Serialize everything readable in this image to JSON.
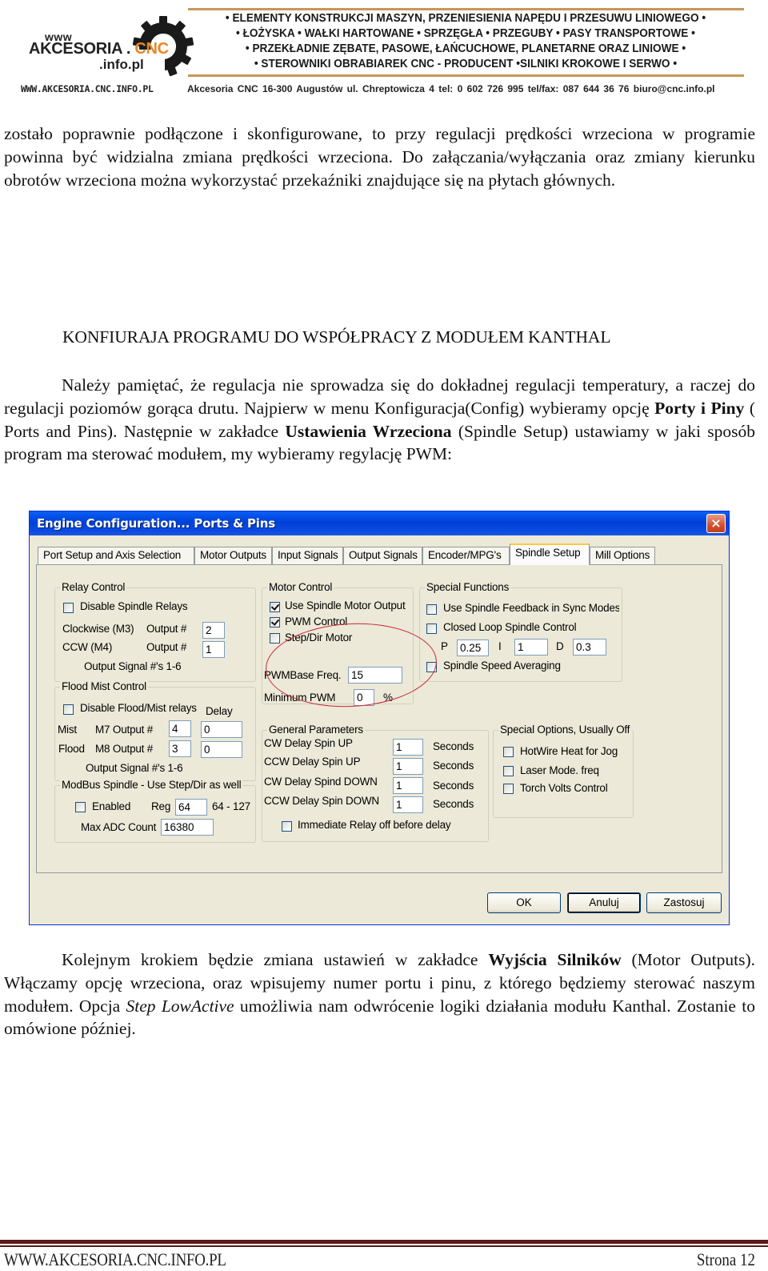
{
  "header": {
    "logo": {
      "www": "www",
      "name": "AKCESORIA . ",
      "cnc": "CNC",
      "domain": ".info.pl",
      "accent_color": "#e8872a"
    },
    "taglines": [
      "• ELEMENTY KONSTRUKCJI MASZYN, PRZENIESIENIA NAPĘDU I PRZESUWU LINIOWEGO •",
      "• ŁOŻYSKA • WAŁKI HARTOWANE • SPRZĘGŁA • PRZEGUBY •  PASY TRANSPORTOWE •",
      "• PRZEKŁADNIE ZĘBATE, PASOWE, ŁAŃCUCHOWE, PLANETARNE ORAZ LINIOWE •",
      "• STEROWNIKI OBRABIAREK CNC - PRODUCENT •SILNIKI KROKOWE I SERWO •"
    ],
    "website": "WWW.AKCESORIA.CNC.INFO.PL",
    "contact": "Akcesoria CNC   16-300 Augustów   ul. Chreptowicza 4    tel: 0 602 726 995 tel/fax: 087 644 36 76  biuro@cnc.info.pl"
  },
  "body": {
    "paragraph1": "zostało poprawnie podłączone i skonfigurowane, to przy regulacji prędkości wrzeciona w programie powinna być widzialna zmiana prędkości wrzeciona. Do załączania/wyłączania oraz zmiany kierunku obrotów wrzeciona można wykorzystać przekaźniki znajdujące się na płytach głównych.",
    "heading": "KONFIURAJA PROGRAMU DO WSPÓŁPRACY Z MODUŁEM KANTHAL",
    "paragraph2": {
      "part1": "Należy pamiętać, że regulacja nie sprowadza się do dokładnej regulacji temperatury, a raczej do regulacji poziomów gorąca drutu. Najpierw w menu Konfiguracja(Config) wybieramy opcję ",
      "bold1": "Porty i Piny",
      "part2": " ( Ports and Pins). Następnie w zakładce ",
      "bold2": "Ustawienia Wrzeciona",
      "part3": " (Spindle Setup) ustawiamy w jaki sposób program ma sterować modułem, my wybieramy regylację PWM:"
    },
    "paragraph3": {
      "part1": "Kolejnym krokiem będzie zmiana ustawień w zakładce ",
      "bold1": "Wyjścia Silników",
      "part2": " (Motor Outputs). Włączamy opcję wrzeciona, oraz wpisujemy numer portu i pinu, z którego będziemy sterować naszym modułem. Opcja ",
      "italic1": "Step LowActive",
      "part3": " umożliwia nam odwrócenie logiki działania modułu Kanthal. Zostanie to omówione później."
    }
  },
  "dialog": {
    "title": "Engine Configuration... Ports & Pins",
    "close_icon": "×",
    "tabs": [
      {
        "label": "Port Setup and Axis Selection",
        "active": false
      },
      {
        "label": "Motor Outputs",
        "active": false
      },
      {
        "label": "Input Signals",
        "active": false
      },
      {
        "label": "Output Signals",
        "active": false
      },
      {
        "label": "Encoder/MPG's",
        "active": false
      },
      {
        "label": "Spindle Setup",
        "active": true
      },
      {
        "label": "Mill Options",
        "active": false
      }
    ],
    "relay_control": {
      "legend": "Relay Control",
      "disable_label": "Disable Spindle Relays",
      "disable_checked": false,
      "cw_label": "Clockwise (M3)",
      "cw_output_label": "Output #",
      "cw_value": "2",
      "ccw_label": "CCW (M4)",
      "ccw_output_label": "Output #",
      "ccw_value": "1",
      "note": "Output Signal #'s 1-6"
    },
    "flood_mist": {
      "legend": "Flood Mist Control",
      "disable_label": "Disable Flood/Mist relays",
      "disable_checked": false,
      "delay_label": "Delay",
      "mist_label": "Mist",
      "mist_output_label": "M7 Output #",
      "mist_value": "4",
      "mist_delay": "0",
      "flood_label": "Flood",
      "flood_output_label": "M8 Output #",
      "flood_value": "3",
      "flood_delay": "0",
      "note": "Output Signal #'s 1-6"
    },
    "modbus": {
      "legend": "ModBus Spindle - Use Step/Dir as well",
      "enabled_label": "Enabled",
      "enabled_checked": false,
      "reg_label": "Reg",
      "reg_value": "64",
      "reg_range": "64 - 127",
      "max_adc_label": "Max ADC Count",
      "max_adc_value": "16380"
    },
    "motor_control": {
      "legend": "Motor Control",
      "use_spindle_label": "Use Spindle Motor Output",
      "use_spindle_checked": true,
      "pwm_label": "PWM Control",
      "pwm_checked": true,
      "stepdir_label": "Step/Dir Motor",
      "stepdir_checked": false,
      "pwm_base_label": "PWMBase Freq.",
      "pwm_base_value": "15",
      "min_pwm_label": "Minimum PWM",
      "min_pwm_value": "0",
      "min_pwm_unit": "%",
      "highlight_color": "#c8283a"
    },
    "special_functions": {
      "legend": "Special Functions",
      "feedback_label": "Use Spindle Feedback in Sync Modes",
      "feedback_checked": false,
      "closed_loop_label": "Closed Loop Spindle Control",
      "closed_loop_checked": false,
      "p_label": "P",
      "p_value": "0.25",
      "i_label": "I",
      "i_value": "1",
      "d_label": "D",
      "d_value": "0.3",
      "averaging_label": "Spindle Speed Averaging",
      "averaging_checked": false
    },
    "general_parameters": {
      "legend": "General Parameters",
      "rows": [
        {
          "label": "CW Delay Spin UP",
          "value": "1",
          "unit": "Seconds"
        },
        {
          "label": "CCW Delay Spin UP",
          "value": "1",
          "unit": "Seconds"
        },
        {
          "label": "CW Delay Spind DOWN",
          "value": "1",
          "unit": "Seconds"
        },
        {
          "label": "CCW Delay Spin DOWN",
          "value": "1",
          "unit": "Seconds"
        }
      ],
      "immediate_label": "Immediate Relay off before delay",
      "immediate_checked": false
    },
    "special_options": {
      "legend": "Special Options, Usually Off",
      "hotwire_label": "HotWire Heat for Jog",
      "laser_label": "Laser Mode. freq",
      "torch_label": "Torch Volts Control"
    },
    "buttons": {
      "ok": "OK",
      "cancel": "Anuluj",
      "apply": "Zastosuj"
    }
  },
  "footer": {
    "website": "WWW.AKCESORIA.CNC.INFO.PL",
    "page": "Strona 12",
    "rule_color": "#5a1a1a"
  }
}
